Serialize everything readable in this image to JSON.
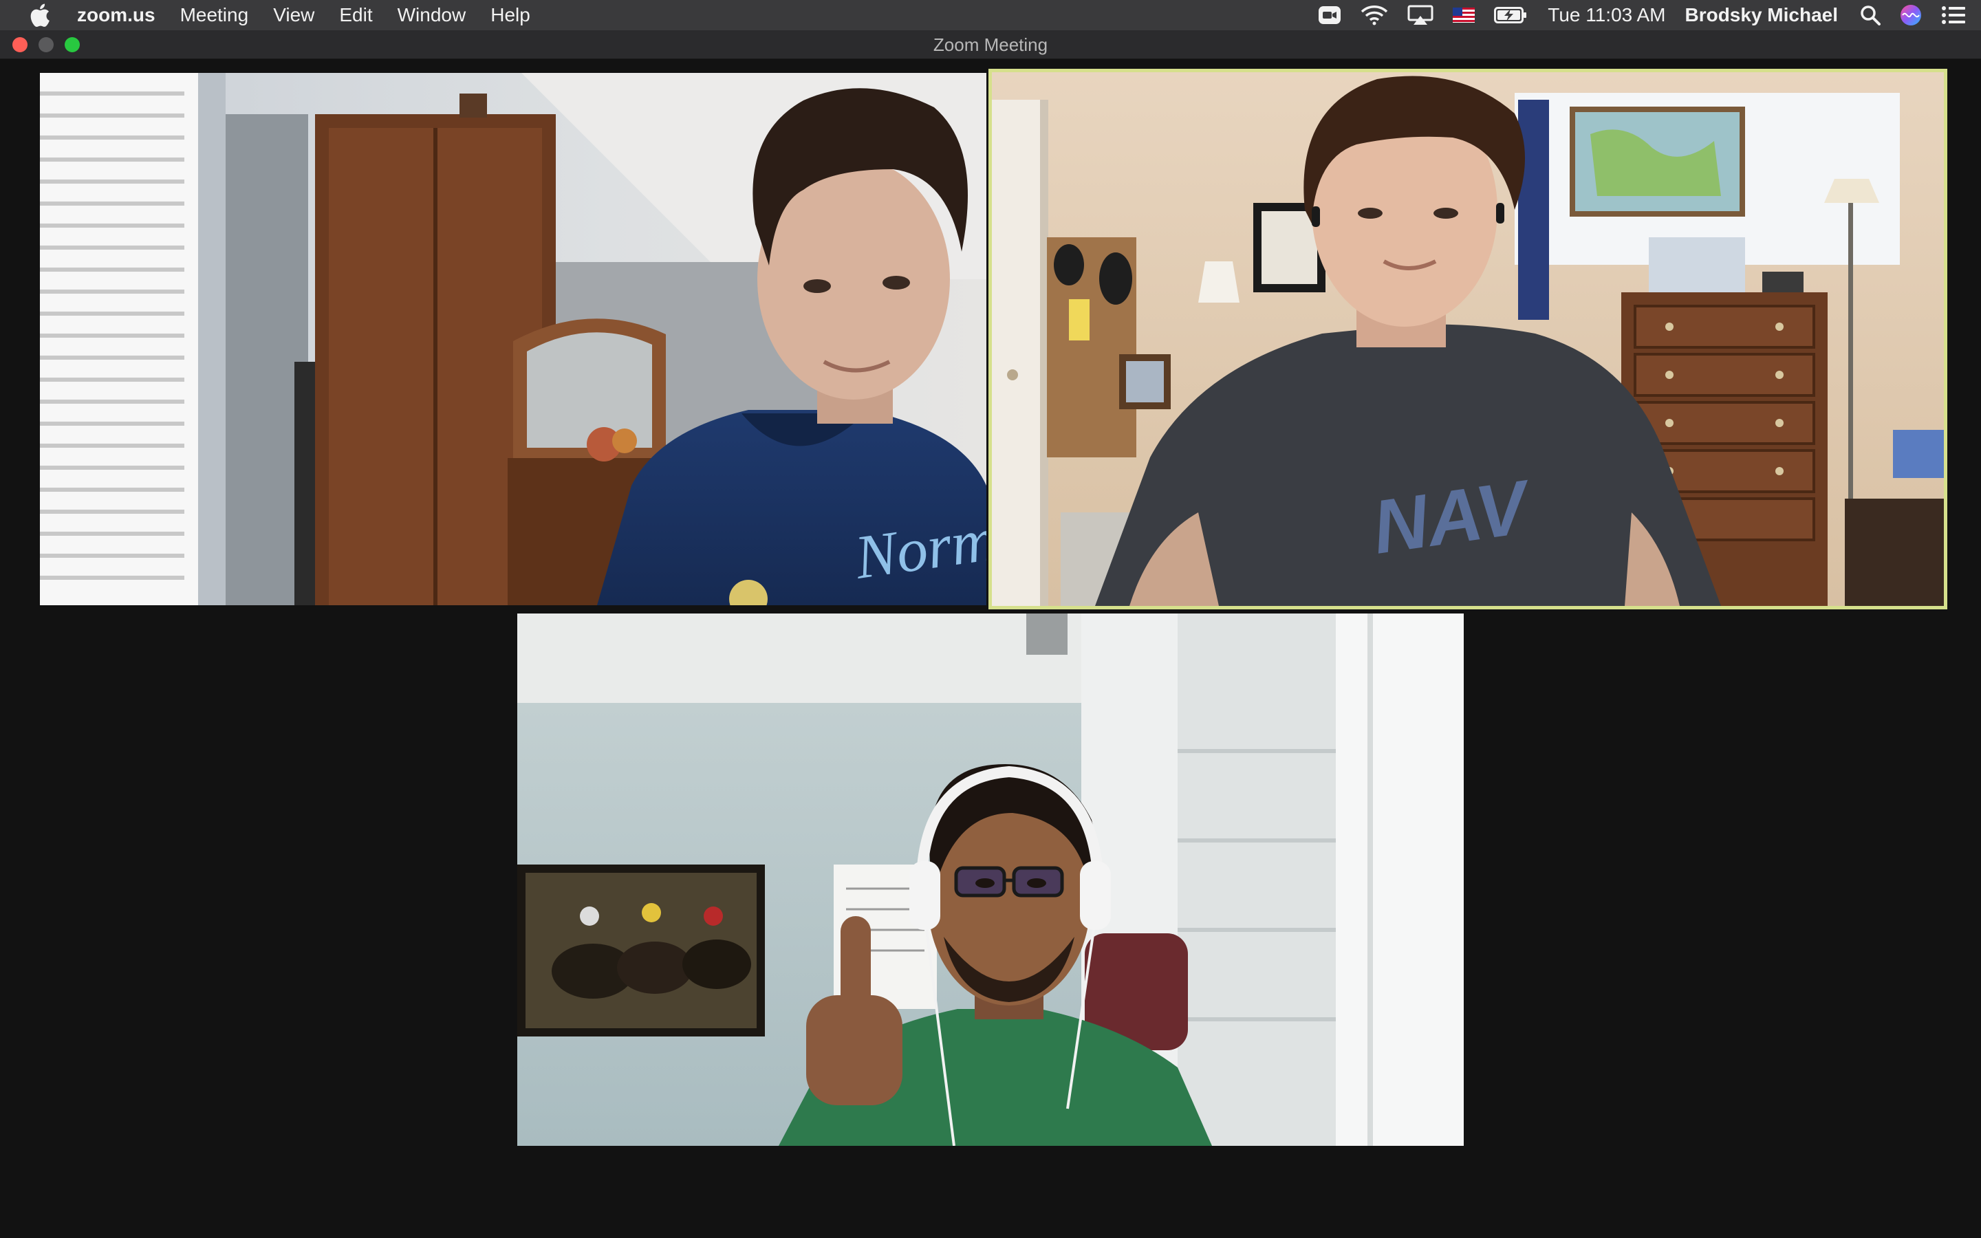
{
  "menubar": {
    "apple_icon": "apple-logo-icon",
    "app_name": "zoom.us",
    "items": [
      "Meeting",
      "View",
      "Edit",
      "Window",
      "Help"
    ],
    "status_icons": [
      "zoom-camera-icon",
      "wifi-icon",
      "airplay-icon",
      "us-flag-input-icon",
      "battery-charging-icon"
    ],
    "clock": "Tue 11:03 AM",
    "user": "Brodsky Michael",
    "right_icons": [
      "spotlight-search-icon",
      "siri-icon",
      "notification-center-icon"
    ]
  },
  "window": {
    "title": "Zoom Meeting",
    "traffic_lights": {
      "close": "#ff5f57",
      "minimize": "#5a5a5c",
      "zoom": "#28c840"
    }
  },
  "gallery": {
    "active_speaker_border_color": "#d6e08c",
    "participants": [
      {
        "scene": "participant in navy hoodie, bedroom with window blinds and wardrobe",
        "active_speaker": false
      },
      {
        "scene": "participant in dark gray t-shirt, room with dresser, lamp and world map",
        "active_speaker": true
      },
      {
        "scene": "participant with white headphones and green t-shirt giving thumbs up, horse racing painting on wall",
        "active_speaker": false
      }
    ]
  }
}
